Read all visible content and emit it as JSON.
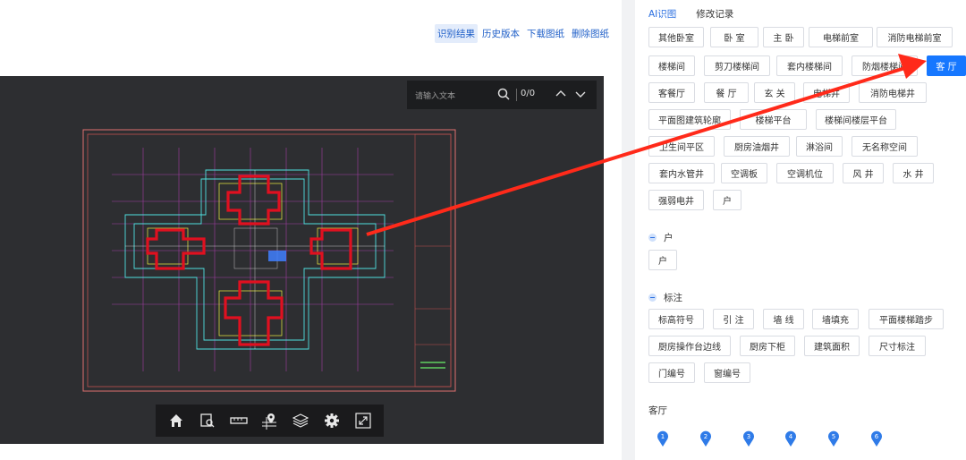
{
  "header": {
    "links": [
      "识别结果",
      "历史版本",
      "下载图纸",
      "删除图纸"
    ],
    "active": "识别结果"
  },
  "viewer": {
    "search_placeholder": "请输入文本",
    "count": "0/0",
    "toolbar_icons": [
      "home-icon",
      "zoom-region-icon",
      "ruler-icon",
      "locate-icon",
      "layers-icon",
      "settings-icon",
      "fullscreen-icon"
    ]
  },
  "panel": {
    "tabs": [
      "AI识图",
      "修改记录"
    ],
    "room_tags": [
      [
        "其他卧室",
        "卧 室",
        "主 卧",
        "电梯前室",
        "消防电梯前室"
      ],
      [
        "楼梯间",
        "剪刀楼梯间",
        "套内楼梯间",
        "防烟楼梯间",
        "客 厅"
      ],
      [
        "客餐厅",
        "餐 厅",
        "玄 关",
        "电梯井",
        "消防电梯井"
      ],
      [
        "平面图建筑轮廓",
        "楼梯平台",
        "楼梯间楼层平台"
      ],
      [
        "卫生间平区",
        "厨房油烟井",
        "淋浴间",
        "无名称空间"
      ],
      [
        "套内水管井",
        "空调板",
        "空调机位",
        "风 井",
        "水 井"
      ],
      [
        "强弱电井",
        "户"
      ]
    ],
    "selected_tag": "客 厅",
    "section_hu": {
      "title": "户",
      "tags": [
        "户"
      ]
    },
    "section_annot": {
      "title": "标注",
      "rows": [
        [
          "标高符号",
          "引 注",
          "墙 线",
          "墙填充",
          "平面楼梯踏步"
        ],
        [
          "厨房操作台边线",
          "厨房下柜",
          "建筑面积",
          "尺寸标注"
        ],
        [
          "门编号",
          "窗编号"
        ]
      ]
    },
    "bottom_section_title": "客厅",
    "pins": [
      "1",
      "2",
      "3",
      "4",
      "5",
      "6"
    ]
  },
  "colors": {
    "accent": "#1677ff",
    "arrow": "#ff2a1a",
    "viewer_bg": "#2d2e31"
  }
}
